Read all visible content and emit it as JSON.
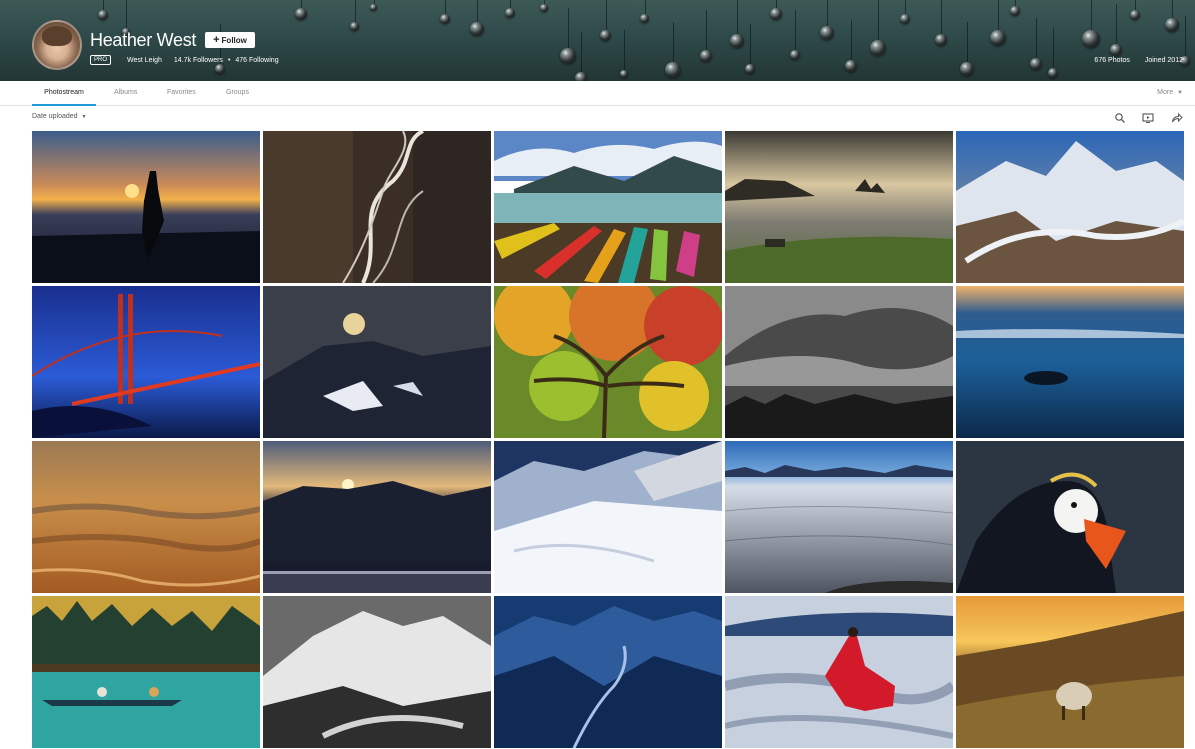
{
  "profile": {
    "name": "Heather West",
    "follow_label": "Follow",
    "pro_label": "PRO",
    "alias": "West Leigh",
    "followers": "14.7k Followers",
    "separator": "•",
    "following": "476 Following",
    "photos": "676 Photos",
    "joined": "Joined 2012"
  },
  "nav": {
    "tabs": [
      "Photostream",
      "Albums",
      "Favorites",
      "Groups"
    ],
    "active_tab": "Photostream",
    "more_label": "More"
  },
  "toolbar": {
    "sort_label": "Date uploaded",
    "icons": [
      "search-icon",
      "slideshow-icon",
      "share-icon"
    ]
  },
  "colors": {
    "accent": "#1d9ad7",
    "cover": "#2f4a4a"
  },
  "photos": [
    {
      "id": "silhouette-sunset",
      "row": 0,
      "col": 0
    },
    {
      "id": "aerial-river-braids",
      "row": 0,
      "col": 1
    },
    {
      "id": "colorful-kayaks",
      "row": 0,
      "col": 2
    },
    {
      "id": "coastal-sea-stacks",
      "row": 0,
      "col": 3
    },
    {
      "id": "aerial-glaciers",
      "row": 0,
      "col": 4
    },
    {
      "id": "golden-gate-bridge",
      "row": 1,
      "col": 0
    },
    {
      "id": "moonrise-mountain",
      "row": 1,
      "col": 1
    },
    {
      "id": "japanese-maple-tree",
      "row": 1,
      "col": 2
    },
    {
      "id": "misty-forest-bw",
      "row": 1,
      "col": 3
    },
    {
      "id": "seal-on-beach",
      "row": 1,
      "col": 4
    },
    {
      "id": "golden-aerial-valley",
      "row": 2,
      "col": 0
    },
    {
      "id": "sunrise-over-ridge",
      "row": 2,
      "col": 1
    },
    {
      "id": "snowy-peaks-wing",
      "row": 2,
      "col": 2
    },
    {
      "id": "icefield-panorama",
      "row": 2,
      "col": 3
    },
    {
      "id": "tufted-puffin",
      "row": 2,
      "col": 4
    },
    {
      "id": "kayakers-lake",
      "row": 3,
      "col": 0
    },
    {
      "id": "mountain-bw",
      "row": 3,
      "col": 1
    },
    {
      "id": "blue-valley-river",
      "row": 3,
      "col": 2
    },
    {
      "id": "red-dress-glacier",
      "row": 3,
      "col": 3
    },
    {
      "id": "sheep-sunset-hills",
      "row": 3,
      "col": 4
    }
  ]
}
